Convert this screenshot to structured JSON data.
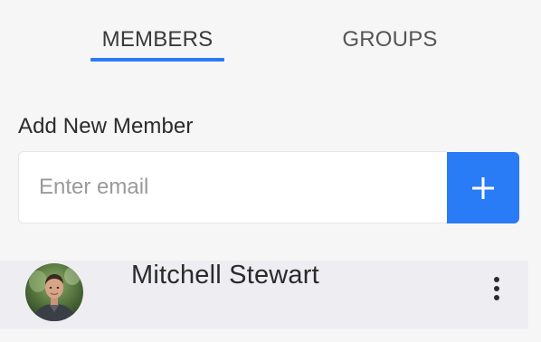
{
  "tabs": {
    "members_label": "MEMBERS",
    "groups_label": "GROUPS",
    "active": "MEMBERS"
  },
  "add_member": {
    "heading": "Add New Member",
    "email_placeholder": "Enter email",
    "email_value": "",
    "add_icon": "plus-icon"
  },
  "members": [
    {
      "name": "Mitchell Stewart",
      "avatar": "avatar-photo",
      "menu_icon": "more-vertical-icon"
    }
  ],
  "colors": {
    "accent": "#2a7bf6",
    "background": "#f6f6f6",
    "row_background": "#eeeef2",
    "text": "#2b2b2b",
    "placeholder": "#9a9a9a"
  }
}
